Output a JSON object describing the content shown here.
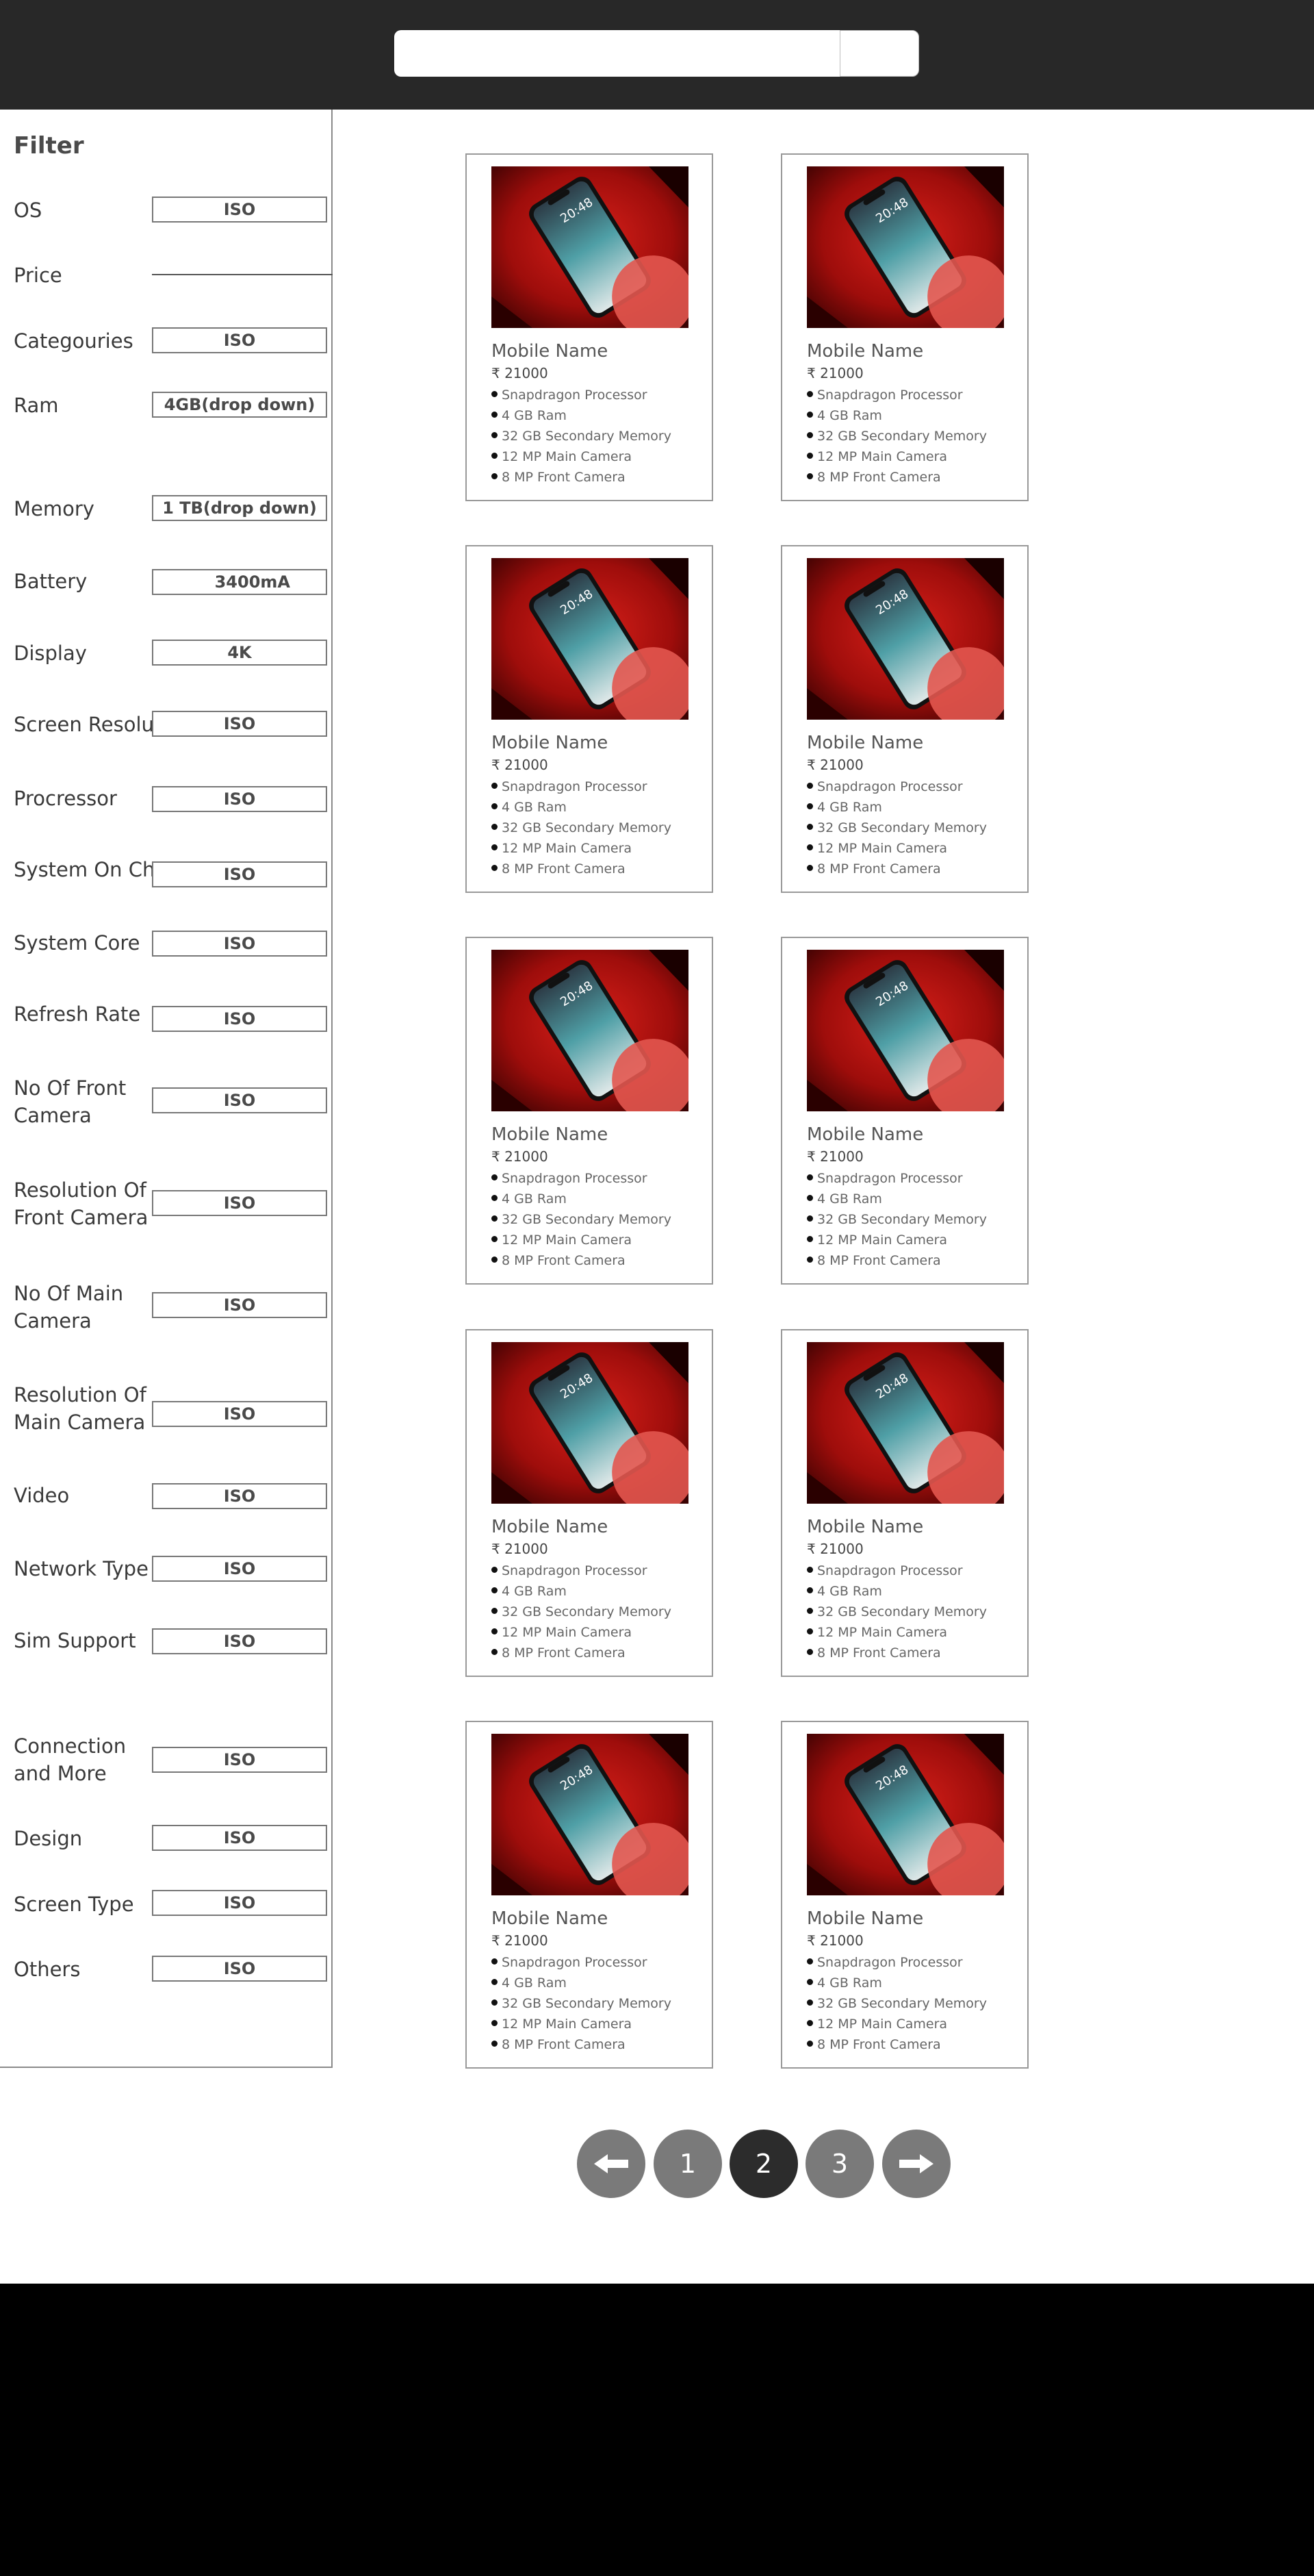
{
  "search": {
    "placeholder": "",
    "value": ""
  },
  "filter": {
    "title": "Filter",
    "rows": [
      {
        "label": "OS",
        "value": "ISO"
      },
      {
        "label": "Price",
        "value": ""
      },
      {
        "label": "Categouries",
        "value": "ISO"
      },
      {
        "label": "Ram",
        "value": "4GB(drop down)"
      },
      {
        "label": "Memory",
        "value": "1 TB(drop down)"
      },
      {
        "label": "Battery",
        "value": "3400mA"
      },
      {
        "label": "Display",
        "value": "4K"
      },
      {
        "label": "Screen Resolution",
        "value": "ISO"
      },
      {
        "label": "Procressor",
        "value": "ISO"
      },
      {
        "label": "System On Chip",
        "value": "ISO"
      },
      {
        "label": "System Core",
        "value": "ISO"
      },
      {
        "label": "Refresh Rate",
        "value": "ISO"
      },
      {
        "label": "No Of Front Camera",
        "value": "ISO"
      },
      {
        "label": "Resolution Of Front Camera",
        "value": "ISO"
      },
      {
        "label": "No Of Main Camera",
        "value": "ISO"
      },
      {
        "label": "Resolution Of Main Camera",
        "value": "ISO"
      },
      {
        "label": "Video",
        "value": "ISO"
      },
      {
        "label": "Network Type",
        "value": "ISO"
      },
      {
        "label": "Sim Support",
        "value": "ISO"
      },
      {
        "label": "Connection and More",
        "value": "ISO"
      },
      {
        "label": "Design",
        "value": "ISO"
      },
      {
        "label": "Screen Type",
        "value": "ISO"
      },
      {
        "label": "Others",
        "value": "ISO"
      }
    ]
  },
  "product": {
    "name": "Mobile Name",
    "price": "₹ 21000",
    "specs": [
      "Snapdragon Processor",
      "4 GB Ram",
      "32 GB Secondary Memory",
      "12 MP Main Camera",
      "8 MP Front Camera"
    ],
    "image_icon": "smartphone-image",
    "screen_time": "20:48"
  },
  "pagination": {
    "prev_icon": "arrow-left-icon",
    "pages": [
      "1",
      "2",
      "3"
    ],
    "active": "2",
    "next_icon": "arrow-right-icon"
  }
}
